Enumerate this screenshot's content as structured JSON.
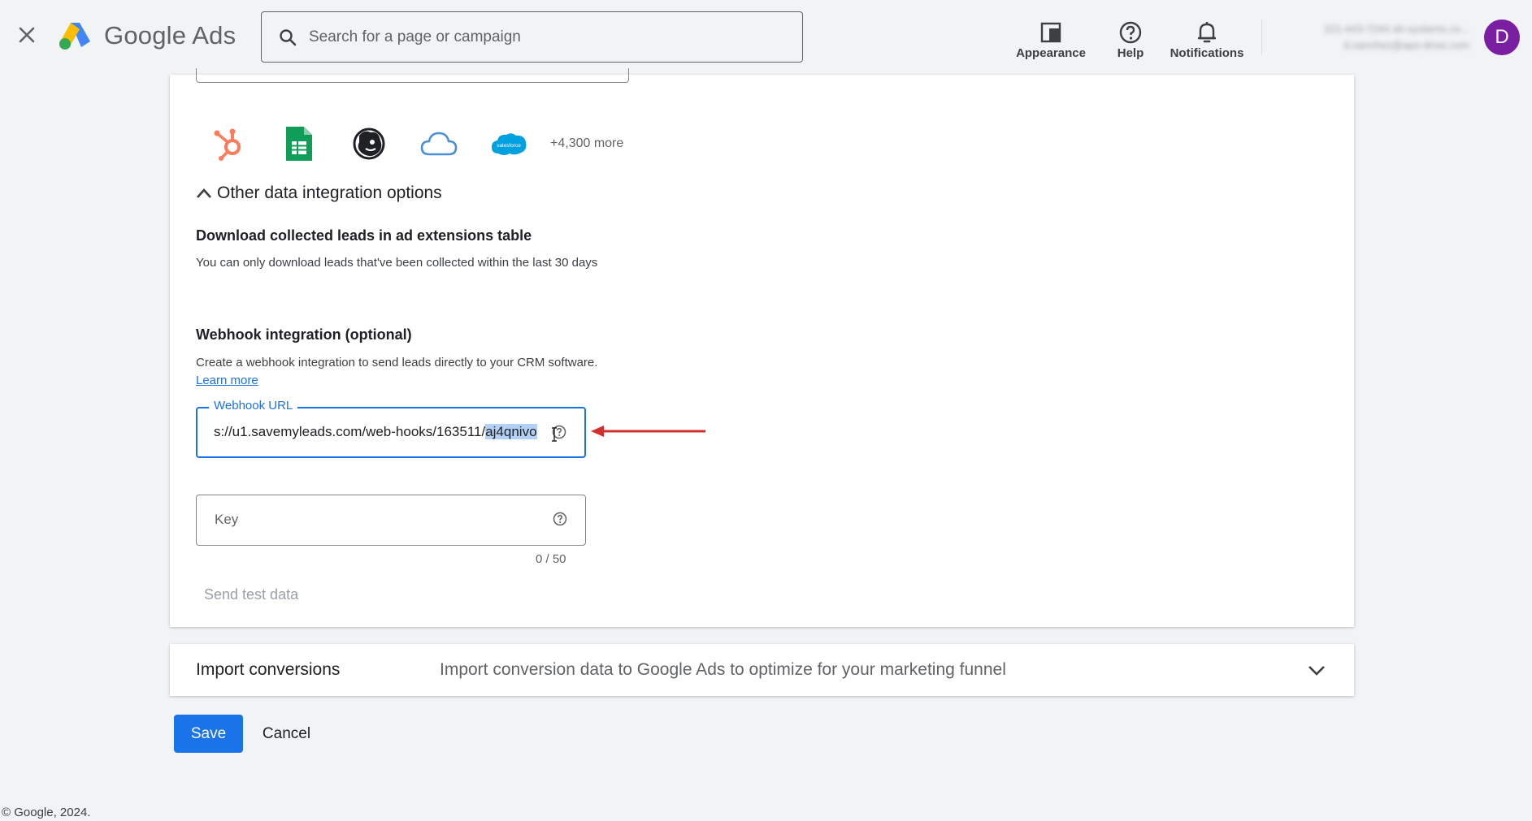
{
  "header": {
    "brand": "Google Ads",
    "search_placeholder": "Search for a page or campaign",
    "tools": {
      "appearance": "Appearance",
      "help": "Help",
      "notifications": "Notifications"
    },
    "account": {
      "line1": "221-443-7244 ah-systems.co...",
      "line2": "d.sanchez@apo-drive.com"
    },
    "avatar_letter": "D"
  },
  "integrations": {
    "icons": [
      "hubspot-icon",
      "google-sheets-icon",
      "mailchimp-icon",
      "cloud-icon",
      "salesforce-icon"
    ],
    "more_label": "+4,300 more"
  },
  "other_options": {
    "toggle_label": "Other data integration options",
    "download": {
      "title": "Download collected leads in ad extensions table",
      "desc": "You can only download leads that've been collected within the last 30 days"
    },
    "webhook": {
      "title": "Webhook integration (optional)",
      "desc": "Create a webhook integration to send leads directly to your CRM software.",
      "learn_more": "Learn more",
      "url_label": "Webhook URL",
      "url_value_prefix": "s://u1.savemyleads.com/web-hooks/163511/",
      "url_value_selected": "aj4qnivo",
      "key_label": "Key",
      "key_counter": "0 / 50",
      "send_test": "Send test data"
    }
  },
  "import_conversions": {
    "title": "Import conversions",
    "subtitle": "Import conversion data to Google Ads to optimize for your marketing funnel"
  },
  "actions": {
    "save": "Save",
    "cancel": "Cancel"
  },
  "footer": "© Google, 2024.",
  "colors": {
    "primary": "#1a73e8",
    "annotation_arrow": "#d32f2f",
    "avatar": "#7b1fa2"
  }
}
